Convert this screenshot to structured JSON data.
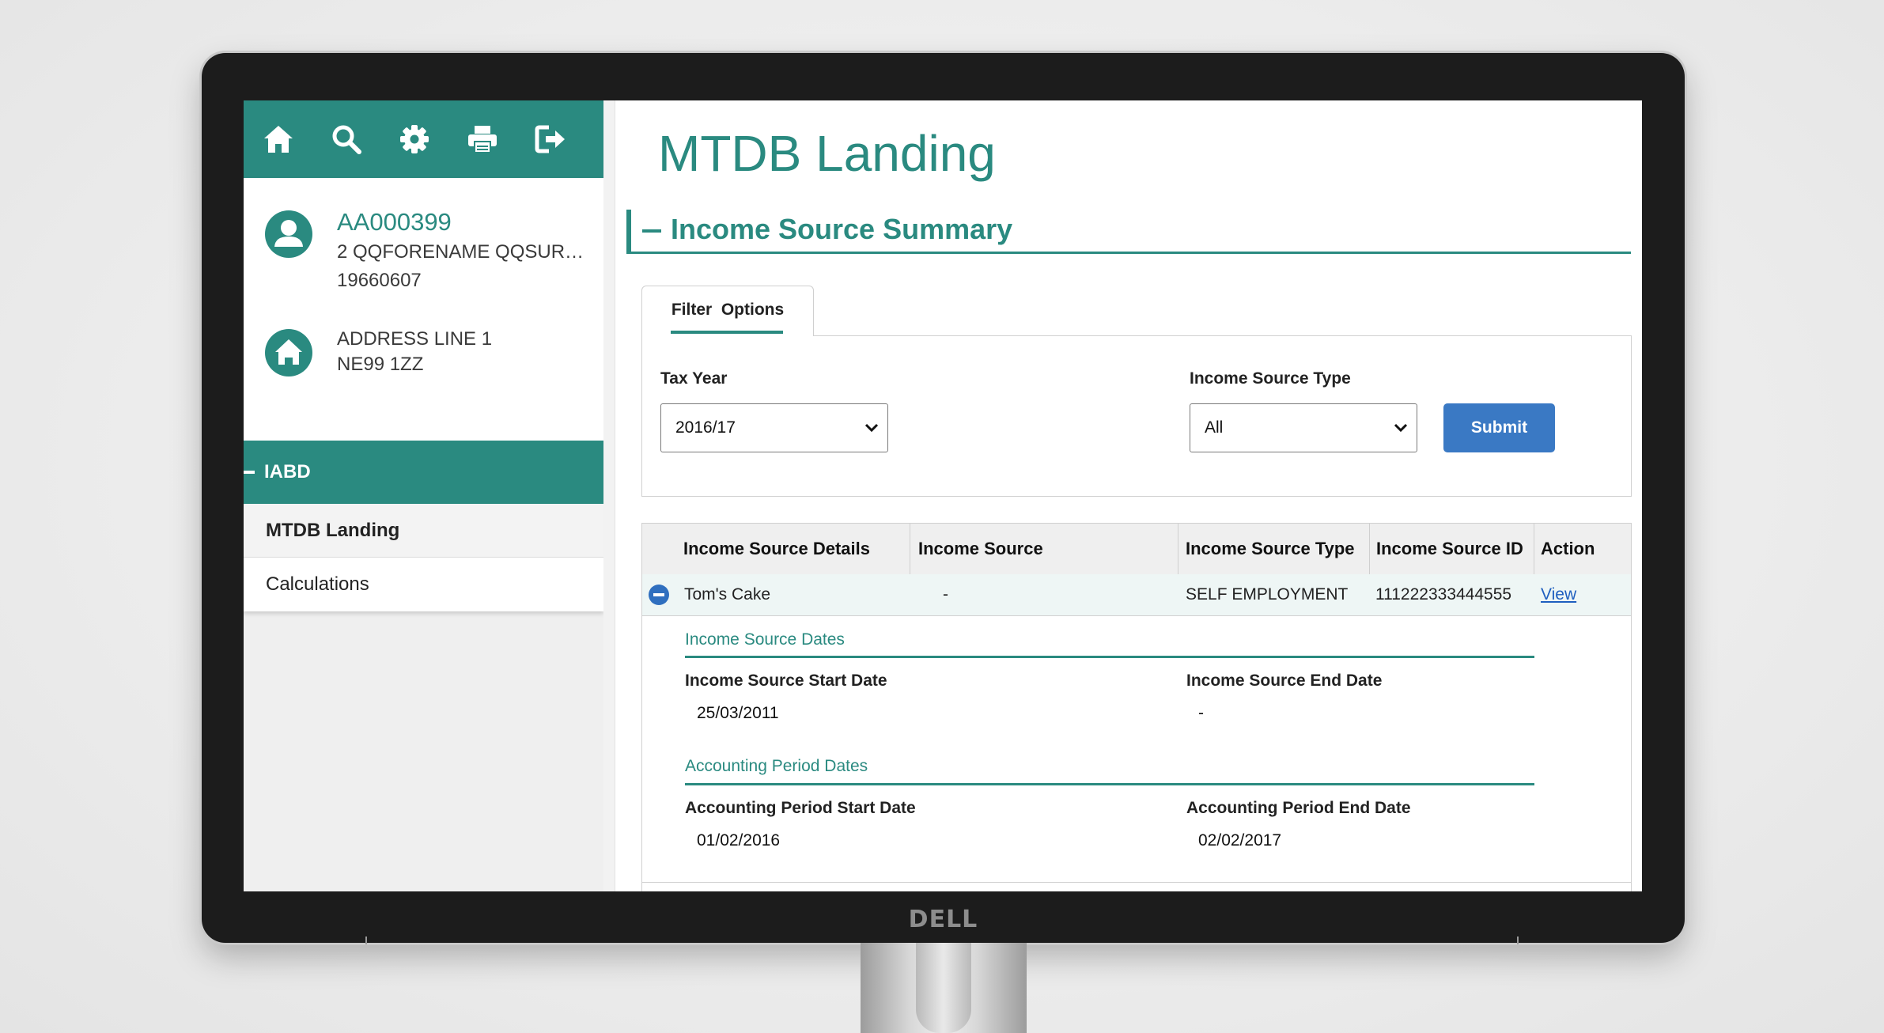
{
  "brand": "DELL",
  "toolbar": {
    "icons": [
      "home-icon",
      "search-icon",
      "gear-icon",
      "printer-icon",
      "logout-icon"
    ]
  },
  "customer": {
    "id": "AA000399",
    "name": "2 QQFORENAME QQSURNAME",
    "dob": "19660607",
    "address_line1": "ADDRESS LINE 1",
    "postcode": "NE99 1ZZ"
  },
  "nav": {
    "section": "IABD",
    "items": [
      {
        "label": "MTDB Landing",
        "active": true
      },
      {
        "label": "Calculations",
        "active": false
      }
    ]
  },
  "page": {
    "title": "MTDB Landing",
    "section_title": "Income Source Summary"
  },
  "filter": {
    "tab_label": "Filter  Options",
    "tax_year_label": "Tax Year",
    "tax_year_value": "2016/17",
    "source_type_label": "Income Source Type",
    "source_type_value": "All",
    "submit_label": "Submit"
  },
  "table": {
    "headers": [
      "Income Source Details",
      "Income Source",
      "Income Source Type",
      "Income Source ID",
      "Action"
    ],
    "rows": [
      {
        "details": "Tom's Cake",
        "source": "-",
        "type": "SELF EMPLOYMENT",
        "id": "111222333444555",
        "action": "View"
      }
    ],
    "expanded": {
      "dates_heading": "Income Source Dates",
      "start_label": "Income Source Start Date",
      "start_value": "25/03/2011",
      "end_label": "Income Source End Date",
      "end_value": "-",
      "accounting_heading": "Accounting Period Dates",
      "acc_start_label": "Accounting Period Start Date",
      "acc_start_value": "01/02/2016",
      "acc_end_label": "Accounting Period End Date",
      "acc_end_value": "02/02/2017"
    }
  },
  "colors": {
    "teal": "#2a8a80",
    "button_blue": "#3a79c4",
    "link_blue": "#1f5fbf"
  }
}
